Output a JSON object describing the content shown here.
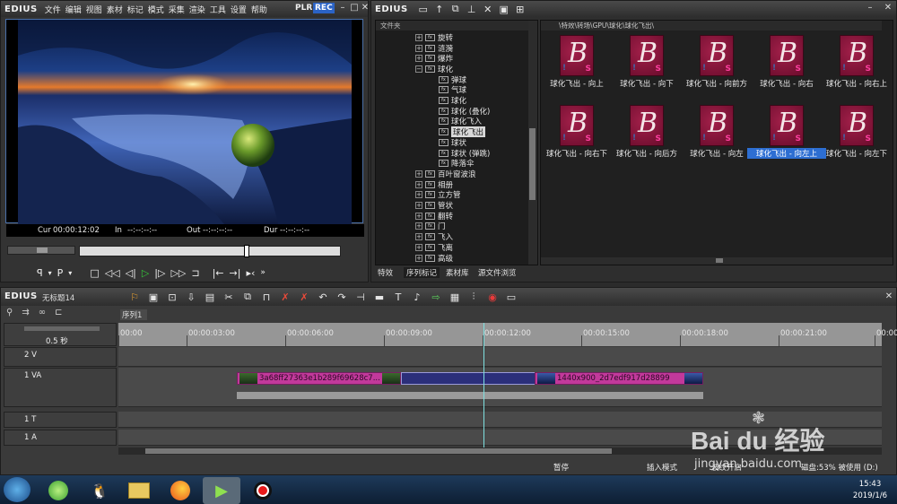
{
  "player": {
    "logo": "EDIUS",
    "menu": [
      "文件",
      "编辑",
      "视图",
      "素材",
      "标记",
      "模式",
      "采集",
      "渲染",
      "工具",
      "设置",
      "帮助"
    ],
    "plr": "PLR",
    "rec": "REC",
    "cur_label": "Cur",
    "cur_value": "00:00:12:02",
    "in_label": "In",
    "in_value": "--:--:--:--",
    "out_label": "Out",
    "out_value": "--:--:--:--",
    "dur_label": "Dur",
    "dur_value": "--:--:--:--"
  },
  "effects": {
    "logo": "EDIUS",
    "folder_header": "文件夹",
    "path": "\\特效\\转场\\GPU\\球化\\球化飞出\\",
    "tree": [
      {
        "label": "旋转",
        "type": "folder",
        "expanded": false
      },
      {
        "label": "涟漪",
        "type": "folder",
        "expanded": false
      },
      {
        "label": "爆炸",
        "type": "folder",
        "expanded": false
      },
      {
        "label": "球化",
        "type": "folder",
        "expanded": true
      },
      {
        "label": "弹球",
        "type": "item"
      },
      {
        "label": "气球",
        "type": "item"
      },
      {
        "label": "球化",
        "type": "item"
      },
      {
        "label": "球化 (叠化)",
        "type": "item"
      },
      {
        "label": "球化飞入",
        "type": "item"
      },
      {
        "label": "球化飞出",
        "type": "item",
        "selected": true
      },
      {
        "label": "球状",
        "type": "item"
      },
      {
        "label": "球状 (弹跳)",
        "type": "item"
      },
      {
        "label": "降落伞",
        "type": "item"
      },
      {
        "label": "百叶窗波浪",
        "type": "folder",
        "expanded": false
      },
      {
        "label": "相册",
        "type": "folder",
        "expanded": false
      },
      {
        "label": "立方管",
        "type": "folder",
        "expanded": false
      },
      {
        "label": "管状",
        "type": "folder",
        "expanded": false
      },
      {
        "label": "翻转",
        "type": "folder",
        "expanded": false
      },
      {
        "label": "门",
        "type": "folder",
        "expanded": false
      },
      {
        "label": "飞入",
        "type": "folder",
        "expanded": false
      },
      {
        "label": "飞离",
        "type": "folder",
        "expanded": false
      },
      {
        "label": "高级",
        "type": "folder",
        "expanded": false
      }
    ],
    "thumbs": [
      {
        "label": "球化飞出 - 向上"
      },
      {
        "label": "球化飞出 - 向下"
      },
      {
        "label": "球化飞出 - 向前方"
      },
      {
        "label": "球化飞出 - 向右"
      },
      {
        "label": "球化飞出 - 向右上"
      },
      {
        "label": "球化飞出 - 向右下"
      },
      {
        "label": "球化飞出 - 向后方"
      },
      {
        "label": "球化飞出 - 向左"
      },
      {
        "label": "球化飞出 - 向左上",
        "selected": true
      },
      {
        "label": "球化飞出 - 向左下"
      }
    ],
    "tabs": [
      "特效",
      "序列标记",
      "素材库",
      "源文件浏览"
    ]
  },
  "timeline": {
    "logo": "EDIUS",
    "project": "无标题14",
    "sequence_tab": "序列1",
    "zoom": "0.5 秒",
    "ruler": [
      "00:00",
      "00:00:03:00",
      "00:00:06:00",
      "00:00:09:00",
      "00:00:12:00",
      "00:00:15:00",
      "00:00:18:00",
      "00:00:21:00",
      "00:00"
    ],
    "tracks": [
      {
        "name": "2 V"
      },
      {
        "name": "1 VA"
      },
      {
        "name": "1 T"
      },
      {
        "name": "1 A"
      }
    ],
    "clip1": "3a68ff27363e1b289f69628c7...",
    "clip2": "1440x900_2d7edf917d28899",
    "status": [
      "暂停",
      "插入模式",
      "波纹开启",
      "磁盘:53% 被使用 (D:)"
    ]
  },
  "taskbar": {
    "time": "15:43",
    "date": "2019/1/6"
  },
  "watermark": {
    "brand": "Bai du 经验",
    "url": "jingyan.baidu.com"
  }
}
